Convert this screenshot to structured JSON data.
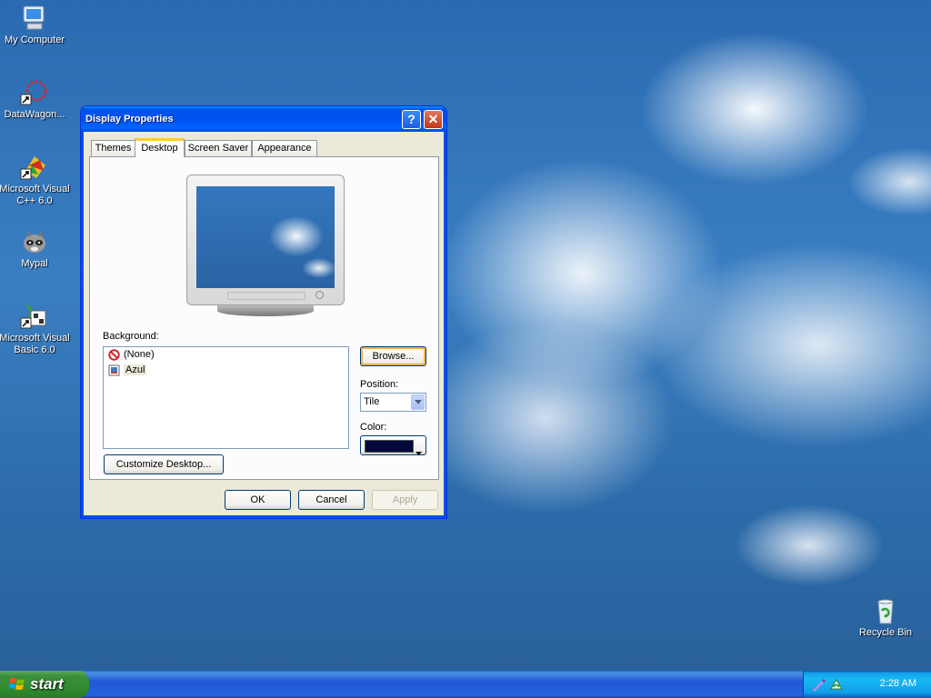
{
  "desktop": {
    "icons": [
      {
        "label": "My Computer"
      },
      {
        "label": "DataWagon..."
      },
      {
        "label": "Microsoft Visual C++ 6.0"
      },
      {
        "label": "Mypal"
      },
      {
        "label": "Microsoft Visual Basic 6.0"
      },
      {
        "label": "Recycle Bin"
      }
    ]
  },
  "window": {
    "title": "Display Properties",
    "help_button": "?",
    "close_button": "✕",
    "tabs": [
      {
        "label": "Themes"
      },
      {
        "label": "Desktop"
      },
      {
        "label": "Screen Saver"
      },
      {
        "label": "Appearance"
      }
    ],
    "active_tab": "Desktop",
    "background_label": "Background:",
    "background_items": [
      {
        "label": "(None)",
        "icon": "no-entry-icon"
      },
      {
        "label": "Azul",
        "icon": "image-file-icon"
      }
    ],
    "browse_button": "Browse...",
    "position_label": "Position:",
    "position_value": "Tile",
    "color_label": "Color:",
    "color_value": "#00083c",
    "customize_button": "Customize Desktop...",
    "ok_button": "OK",
    "cancel_button": "Cancel",
    "apply_button": "Apply"
  },
  "taskbar": {
    "start_label": "start",
    "clock": "2:28 AM"
  }
}
